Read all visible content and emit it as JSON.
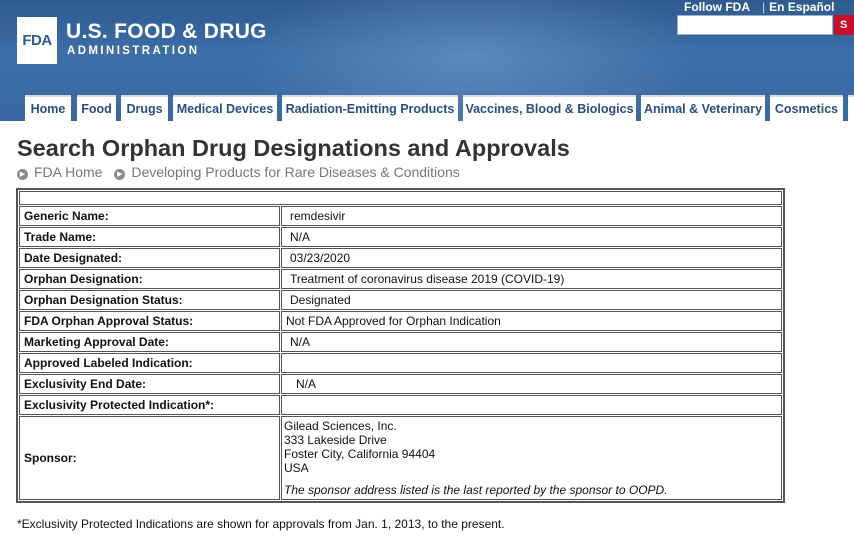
{
  "header": {
    "logo_text": "FDA",
    "agency_name": "U.S. FOOD & DRUG",
    "agency_sub": "ADMINISTRATION",
    "util_links": [
      "Follow FDA",
      "En Español"
    ],
    "search_button": "S",
    "brand_color": "#2e5a8e"
  },
  "nav": {
    "tabs": [
      "Home",
      "Food",
      "Drugs",
      "Medical Devices",
      "Radiation-Emitting Products",
      "Vaccines, Blood & Biologics",
      "Animal & Veterinary",
      "Cosmetics"
    ]
  },
  "page": {
    "title": "Search Orphan Drug Designations and Approvals",
    "breadcrumbs": [
      "FDA Home",
      "Developing Products for Rare Diseases & Conditions"
    ]
  },
  "table": {
    "rows": [
      {
        "label": "Generic Name:",
        "value": "remdesivir"
      },
      {
        "label": "Trade Name:",
        "value": "N/A"
      },
      {
        "label": "Date Designated:",
        "value": "03/23/2020"
      },
      {
        "label": "Orphan Designation:",
        "value": "Treatment of coronavirus disease 2019 (COVID-19)"
      },
      {
        "label": "Orphan Designation Status:",
        "value": "Designated"
      },
      {
        "label": "FDA Orphan Approval Status:",
        "value": "Not FDA Approved for Orphan Indication"
      },
      {
        "label": "Marketing Approval Date:",
        "value": "N/A"
      },
      {
        "label": "Approved Labeled Indication:",
        "value": ""
      },
      {
        "label": "Exclusivity End Date:",
        "value": "N/A"
      },
      {
        "label": "Exclusivity Protected Indication*:",
        "value": ""
      }
    ],
    "sponsor": {
      "label": "Sponsor:",
      "lines": [
        "Gilead Sciences, Inc.",
        "333 Lakeside Drive",
        "Foster City, California 94404",
        "USA"
      ],
      "note": "The sponsor address listed is the last reported by the sponsor to OOPD."
    }
  },
  "footnote": "*Exclusivity Protected Indications are shown for approvals from Jan. 1, 2013, to the present."
}
